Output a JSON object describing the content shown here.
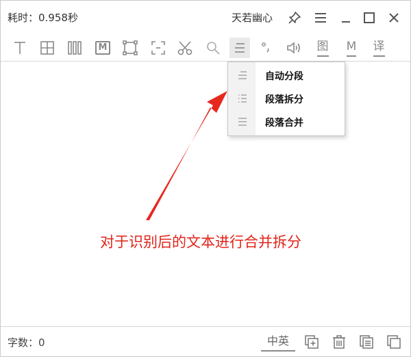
{
  "titlebar": {
    "elapsed": "耗时：0.958秒",
    "user_name": "天若幽心",
    "icons": [
      "pin-icon",
      "menu-icon",
      "minimize-icon",
      "maximize-icon",
      "close-icon"
    ]
  },
  "toolbar": {
    "image_label": "图",
    "model_label": "M",
    "translate_label": "译",
    "icons": [
      "text-icon",
      "table-icon",
      "vertical-text-icon",
      "markdown-icon",
      "select-region-icon",
      "capture-icon",
      "scissors-icon",
      "search-icon",
      "paragraph-icon",
      "degree-icon",
      "speaker-icon"
    ]
  },
  "paragraph_menu": {
    "items": [
      {
        "label": "自动分段",
        "icon": "lines-icon"
      },
      {
        "label": "段落拆分",
        "icon": "list-icon"
      },
      {
        "label": "段落合并",
        "icon": "lines-icon"
      }
    ]
  },
  "annotation": {
    "text": "对于识别后的文本进行合并拆分",
    "color": "#e0241b"
  },
  "statusbar": {
    "word_count": "字数：0",
    "lang_label": "中英",
    "icons": [
      "add-page-icon",
      "delete-icon",
      "copy-icon",
      "duplicate-icon"
    ]
  }
}
